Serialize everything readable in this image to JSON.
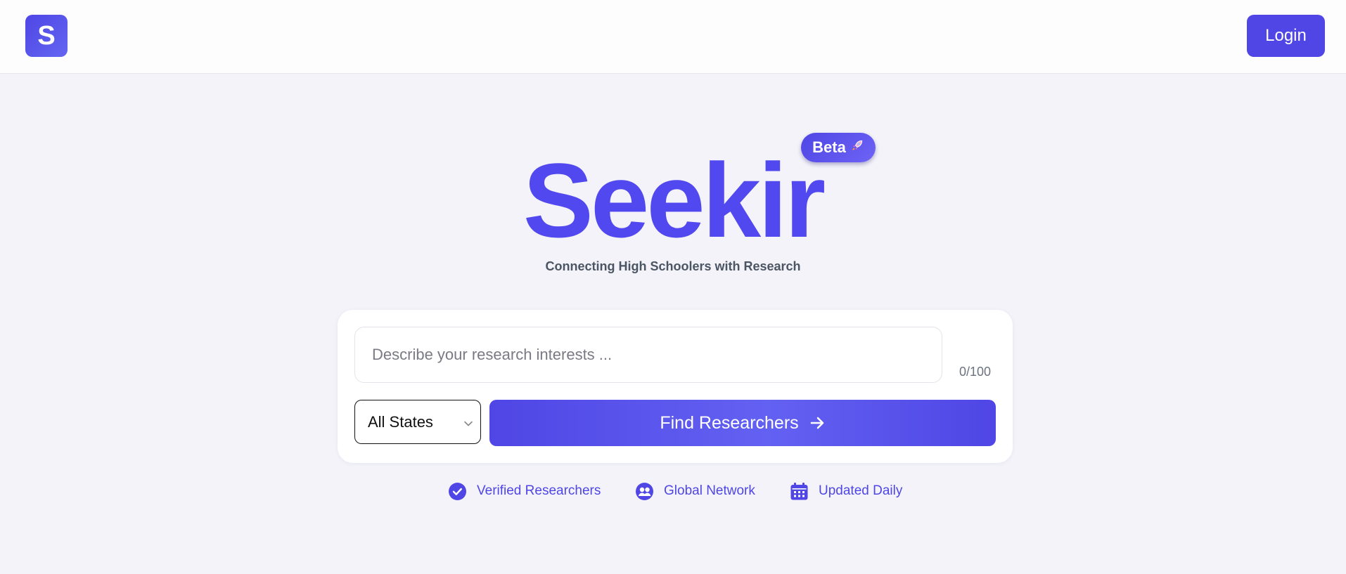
{
  "header": {
    "logo_text": "S",
    "login_label": "Login"
  },
  "hero": {
    "title": "Seekir",
    "badge_label": "Beta",
    "badge_icon": "rocket-icon",
    "subtitle": "Connecting High Schoolers with Research"
  },
  "search": {
    "placeholder": "Describe your research interests ...",
    "value": "",
    "counter": "0/100",
    "state_selected": "All States",
    "find_label": "Find Researchers"
  },
  "features": [
    {
      "label": "Verified Researchers",
      "icon": "check-circle-icon"
    },
    {
      "label": "Global Network",
      "icon": "people-icon"
    },
    {
      "label": "Updated Daily",
      "icon": "calendar-icon"
    }
  ],
  "colors": {
    "accent": "#4f46e5",
    "background": "#f3f3f9",
    "subtitle": "#4b5563"
  }
}
